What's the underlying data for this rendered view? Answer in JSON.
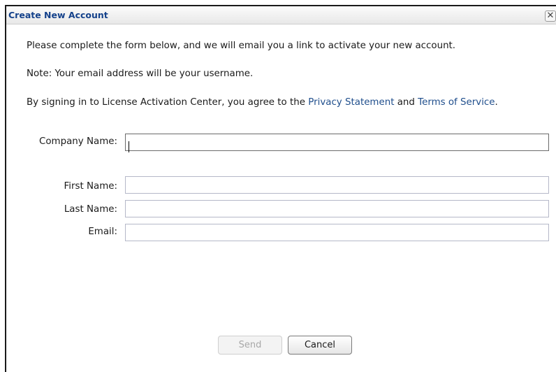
{
  "dialog": {
    "title": "Create New Account",
    "close_glyph": "✕"
  },
  "intro": {
    "line1": "Please complete the form below, and we will email you a link to activate your new account.",
    "line2": "Note: Your email address will be your username.",
    "line3_prefix": "By signing in to License Activation Center, you agree to the ",
    "privacy_link": "Privacy Statement",
    "line3_and": " and ",
    "terms_link": "Terms of Service",
    "line3_suffix": "."
  },
  "form": {
    "company_label": "Company Name:",
    "company_value": "",
    "first_label": "First Name:",
    "first_value": "",
    "last_label": "Last Name:",
    "last_value": "",
    "email_label": "Email:",
    "email_value": ""
  },
  "buttons": {
    "send": "Send",
    "cancel": "Cancel"
  },
  "colors": {
    "title_text": "#15428b",
    "link": "#1f4e8c",
    "send_disabled_text": "#a8a8a8"
  },
  "icons": {
    "close": "close-icon"
  }
}
